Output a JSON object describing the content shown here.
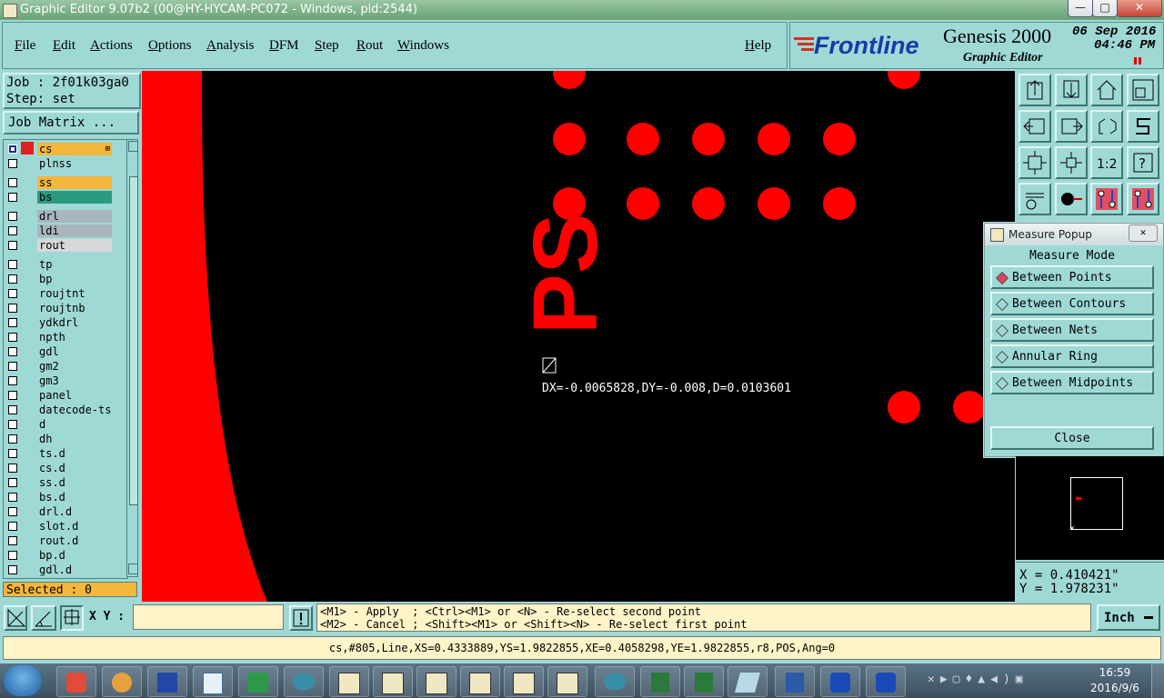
{
  "window": {
    "title": "Graphic Editor 9.07b2 (00@HY-HYCAM-PC072 - Windows, pid:2544)",
    "min": "—",
    "max": "□",
    "close": "✕"
  },
  "menu": {
    "items": [
      "File",
      "Edit",
      "Actions",
      "Options",
      "Analysis",
      "DFM",
      "Step",
      "Rout",
      "Windows"
    ],
    "help": "Help"
  },
  "brand": {
    "logo": "Frontline",
    "product": "Genesis 2000",
    "subtitle": "Graphic Editor",
    "date": "06 Sep 2016",
    "time": "04:46 PM"
  },
  "job": {
    "job": "Job : 2f01k03ga0",
    "step": "Step: set",
    "matrix_button": "Job Matrix ...",
    "selected": "Selected : 0"
  },
  "layers": [
    {
      "name": "cs",
      "bg": "#f5b63c"
    },
    {
      "name": "plnss",
      "bg": "#9fd9d6"
    },
    {
      "name": "ss",
      "bg": "#f5b63c"
    },
    {
      "name": "bs",
      "bg": "#2a9a7e"
    },
    {
      "name": "drl",
      "bg": "#a9b6bd"
    },
    {
      "name": "ldi",
      "bg": "#a9b6bd"
    },
    {
      "name": "rout",
      "bg": "#d8d8d8"
    },
    {
      "name": "tp",
      "bg": "#9fd9d6"
    },
    {
      "name": "bp",
      "bg": "#9fd9d6"
    },
    {
      "name": "roujtnt",
      "bg": "#9fd9d6"
    },
    {
      "name": "roujtnb",
      "bg": "#9fd9d6"
    },
    {
      "name": "ydkdrl",
      "bg": "#9fd9d6"
    },
    {
      "name": "npth",
      "bg": "#9fd9d6"
    },
    {
      "name": "gdl",
      "bg": "#9fd9d6"
    },
    {
      "name": "gm2",
      "bg": "#9fd9d6"
    },
    {
      "name": "gm3",
      "bg": "#9fd9d6"
    },
    {
      "name": "panel",
      "bg": "#9fd9d6"
    },
    {
      "name": "datecode-ts",
      "bg": "#9fd9d6"
    },
    {
      "name": "d",
      "bg": "#9fd9d6"
    },
    {
      "name": "dh",
      "bg": "#9fd9d6"
    },
    {
      "name": "ts.d",
      "bg": "#9fd9d6"
    },
    {
      "name": "cs.d",
      "bg": "#9fd9d6"
    },
    {
      "name": "ss.d",
      "bg": "#9fd9d6"
    },
    {
      "name": "bs.d",
      "bg": "#9fd9d6"
    },
    {
      "name": "drl.d",
      "bg": "#9fd9d6"
    },
    {
      "name": "slot.d",
      "bg": "#9fd9d6"
    },
    {
      "name": "rout.d",
      "bg": "#9fd9d6"
    },
    {
      "name": "bp.d",
      "bg": "#9fd9d6"
    },
    {
      "name": "gdl.d",
      "bg": "#9fd9d6"
    }
  ],
  "canvas": {
    "measure_text": "DX=-0.0065828,DY=-0.008,D=0.0103601",
    "silk_text": "PS"
  },
  "measure_popup": {
    "title": "Measure Popup",
    "heading": "Measure Mode",
    "options": [
      "Between Points",
      "Between Contours",
      "Between Nets",
      "Annular Ring",
      "Between Midpoints"
    ],
    "selected": "Between Points",
    "close": "Close"
  },
  "coords": {
    "x": "X = 0.410421\"",
    "y": "Y = 1.978231\""
  },
  "bottom": {
    "xy_label": "X Y :",
    "xy_value": "",
    "hint1": "<M1> - Apply  ; <Ctrl><M1> or <N> - Re-select second point",
    "hint2": "<M2> - Cancel ; <Shift><M1> or <Shift><N> - Re-select first point",
    "units": "Inch",
    "status": "cs,#805,Line,XS=0.4333889,YS=1.9822855,XE=0.4058298,YE=1.9822855,r8,POS,Ang=0"
  },
  "taskbar": {
    "time": "16:59",
    "date": "2016/9/6"
  },
  "colors": {
    "feature": "#ff0000",
    "canvas_bg": "#000000",
    "panel": "#9fd9d6"
  }
}
